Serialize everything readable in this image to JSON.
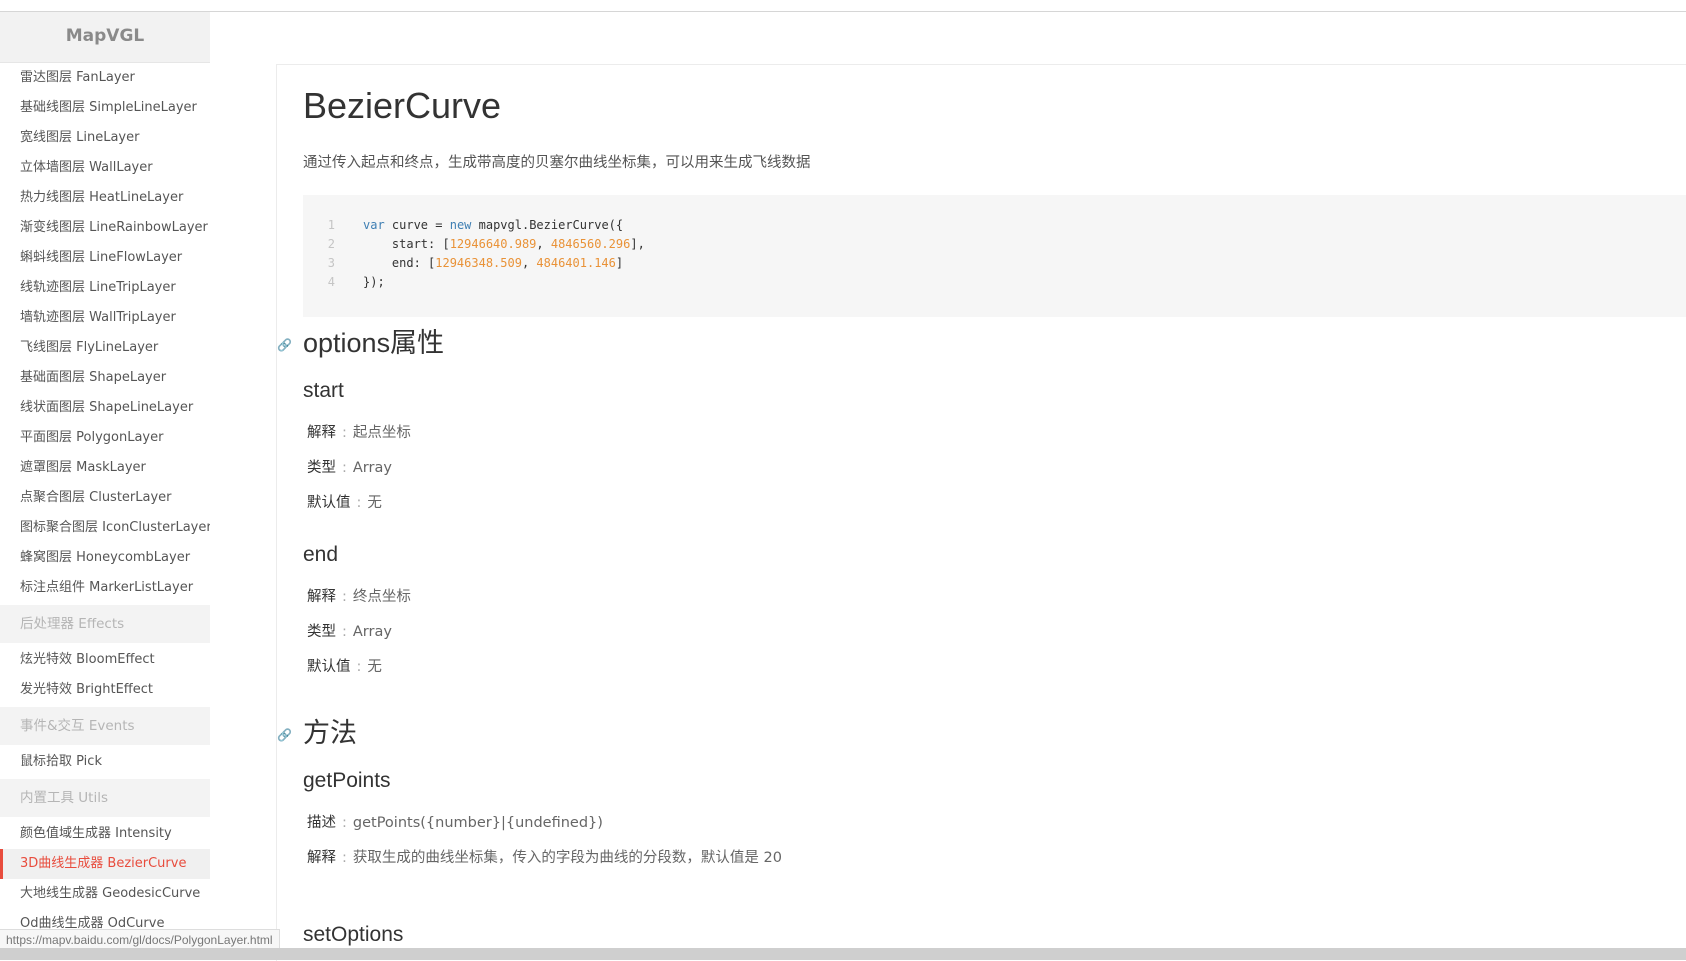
{
  "sidebar": {
    "brand": "MapVGL",
    "items": [
      {
        "label": "雷达图层 FanLayer",
        "kind": "item"
      },
      {
        "label": "基础线图层 SimpleLineLayer",
        "kind": "item"
      },
      {
        "label": "宽线图层 LineLayer",
        "kind": "item"
      },
      {
        "label": "立体墙图层 WallLayer",
        "kind": "item"
      },
      {
        "label": "热力线图层 HeatLineLayer",
        "kind": "item"
      },
      {
        "label": "渐变线图层 LineRainbowLayer",
        "kind": "item"
      },
      {
        "label": "蝌蚪线图层 LineFlowLayer",
        "kind": "item"
      },
      {
        "label": "线轨迹图层 LineTripLayer",
        "kind": "item"
      },
      {
        "label": "墙轨迹图层 WallTripLayer",
        "kind": "item"
      },
      {
        "label": "飞线图层 FlyLineLayer",
        "kind": "item"
      },
      {
        "label": "基础面图层 ShapeLayer",
        "kind": "item"
      },
      {
        "label": "线状面图层 ShapeLineLayer",
        "kind": "item"
      },
      {
        "label": "平面图层 PolygonLayer",
        "kind": "item"
      },
      {
        "label": "遮罩图层 MaskLayer",
        "kind": "item"
      },
      {
        "label": "点聚合图层 ClusterLayer",
        "kind": "item"
      },
      {
        "label": "图标聚合图层 IconClusterLayer",
        "kind": "item"
      },
      {
        "label": "蜂窝图层 HoneycombLayer",
        "kind": "item"
      },
      {
        "label": "标注点组件 MarkerListLayer",
        "kind": "item"
      },
      {
        "label": "后处理器 Effects",
        "kind": "group"
      },
      {
        "label": "炫光特效 BloomEffect",
        "kind": "item"
      },
      {
        "label": "发光特效 BrightEffect",
        "kind": "item"
      },
      {
        "label": "事件&交互 Events",
        "kind": "group"
      },
      {
        "label": "鼠标拾取 Pick",
        "kind": "item"
      },
      {
        "label": "内置工具 Utils",
        "kind": "group"
      },
      {
        "label": "颜色值域生成器 Intensity",
        "kind": "item"
      },
      {
        "label": "3D曲线生成器 BezierCurve",
        "kind": "item",
        "active": true
      },
      {
        "label": "大地线生成器 GeodesicCurve",
        "kind": "item"
      },
      {
        "label": "Od曲线生成器 OdCurve",
        "kind": "item"
      }
    ]
  },
  "main": {
    "title": "BezierCurve",
    "description": "通过传入起点和终点，生成带高度的贝塞尔曲线坐标集，可以用来生成飞线数据",
    "code": {
      "line_numbers": [
        "1",
        "2",
        "3",
        "4"
      ],
      "l1_kw1": "var",
      "l1_mid": " curve = ",
      "l1_kw2": "new",
      "l1_rest": " mapvgl.BezierCurve({",
      "l2_pre": "    start: [",
      "l2_n1": "12946640.989",
      "l2_comma": ", ",
      "l2_n2": "4846560.296",
      "l2_post": "],",
      "l3_pre": "    end: [",
      "l3_n1": "12946348.509",
      "l3_comma": ", ",
      "l3_n2": "4846401.146",
      "l3_post": "]",
      "l4": "});"
    },
    "options_heading": "options属性",
    "options": [
      {
        "name": "start",
        "desc_label": "解释",
        "desc": "起点坐标",
        "type_label": "类型",
        "type": "Array",
        "default_label": "默认值",
        "default": "无"
      },
      {
        "name": "end",
        "desc_label": "解释",
        "desc": "终点坐标",
        "type_label": "类型",
        "type": "Array",
        "default_label": "默认值",
        "default": "无"
      }
    ],
    "methods_heading": "方法",
    "methods": [
      {
        "name": "getPoints",
        "sig_label": "描述",
        "signature": "getPoints({number}|{undefined})",
        "desc_label": "解释",
        "desc": "获取生成的曲线坐标集，传入的字段为曲线的分段数，默认值是 20"
      },
      {
        "name": "setOptions"
      }
    ],
    "separator": ":"
  },
  "status_bar": {
    "url": "https://mapv.baidu.com/gl/docs/PolygonLayer.html"
  },
  "colors": {
    "accent": "#e84c3d",
    "keyword": "#3f7fb3",
    "number": "#e99237"
  }
}
